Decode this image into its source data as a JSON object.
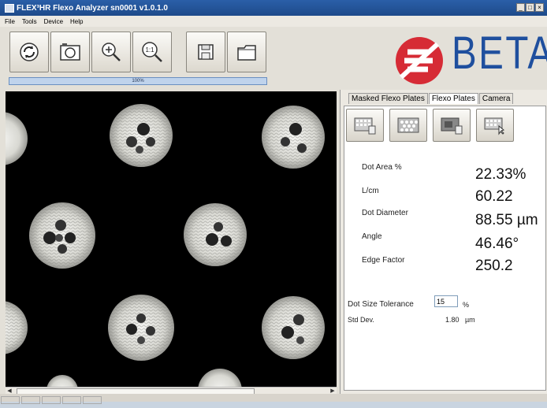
{
  "window": {
    "title": "FLEX³HR Flexo Analyzer sn0001 v1.0.1.0",
    "controls": [
      "_",
      "□",
      "×"
    ]
  },
  "menu": [
    "File",
    "Tools",
    "Device",
    "Help"
  ],
  "toolbar": {
    "buttons": [
      {
        "name": "refresh",
        "icon": "refresh-icon"
      },
      {
        "name": "capture",
        "icon": "camera-icon"
      },
      {
        "name": "zoom-in",
        "icon": "zoom-in-icon"
      },
      {
        "name": "zoom-1-1",
        "icon": "zoom-actual-icon",
        "label": "1:1"
      },
      {
        "name": "save",
        "icon": "floppy-disk-icon"
      },
      {
        "name": "open",
        "icon": "folder-icon"
      }
    ],
    "progress": {
      "label": "100%",
      "value": 1.0
    }
  },
  "logo": {
    "text": "BETA",
    "color": "#1f4f9e",
    "mark_color": "#d62b35"
  },
  "tabs": [
    "Masked Flexo Plates",
    "Flexo Plates",
    "Camera"
  ],
  "active_tab": "Flexo Plates",
  "results": {
    "dot_area_label": "Dot Area %",
    "dot_area_value": "22.33%",
    "lcm_label": "L/cm",
    "lcm_value": "60.22",
    "diameter_label": "Dot Diameter",
    "diameter_value": "88.55 µm",
    "angle_label": "Angle",
    "angle_value": "46.46°",
    "edge_label": "Edge Factor",
    "edge_value": "250.2"
  },
  "tolerance": {
    "label": "Dot Size Tolerance",
    "value": "15",
    "unit": "%"
  },
  "stddev": {
    "label": "Std Dev.",
    "value": "1.80",
    "unit": "µm"
  }
}
